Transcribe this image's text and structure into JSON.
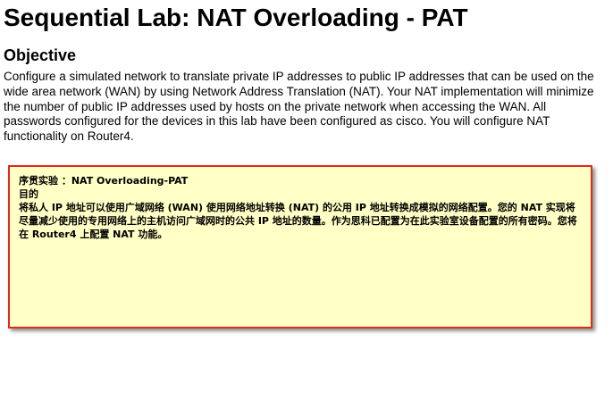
{
  "page": {
    "title": "Sequential Lab: NAT Overloading - PAT",
    "objective_heading": "Objective",
    "objective_text": "Configure a simulated network to translate private IP addresses to public IP addresses that can be used on the wide area network (WAN) by using Network Address Translation (NAT). Your NAT implementation will minimize the number of public IP addresses used by hosts on the private network when accessing the WAN. All passwords configured for the devices in this lab have been configured as cisco. You will configure NAT functionality on Router4."
  },
  "translation_box": {
    "title": "序贯实验 ：NAT Overloading-PAT",
    "heading": "目的",
    "body": "将私人 IP 地址可以使用广域网络 (WAN) 使用网络地址转换 (NAT) 的公用 IP 地址转换成模拟的网络配置。您的 NAT 实现将尽量减少使用的专用网络上的主机访问广域网时的公共 IP 地址的数量。作为思科已配置为在此实验室设备配置的所有密码。您将在 Router4 上配置 NAT 功能。",
    "border_color": "#dd2b1e",
    "background_color": "#ffffc6"
  }
}
